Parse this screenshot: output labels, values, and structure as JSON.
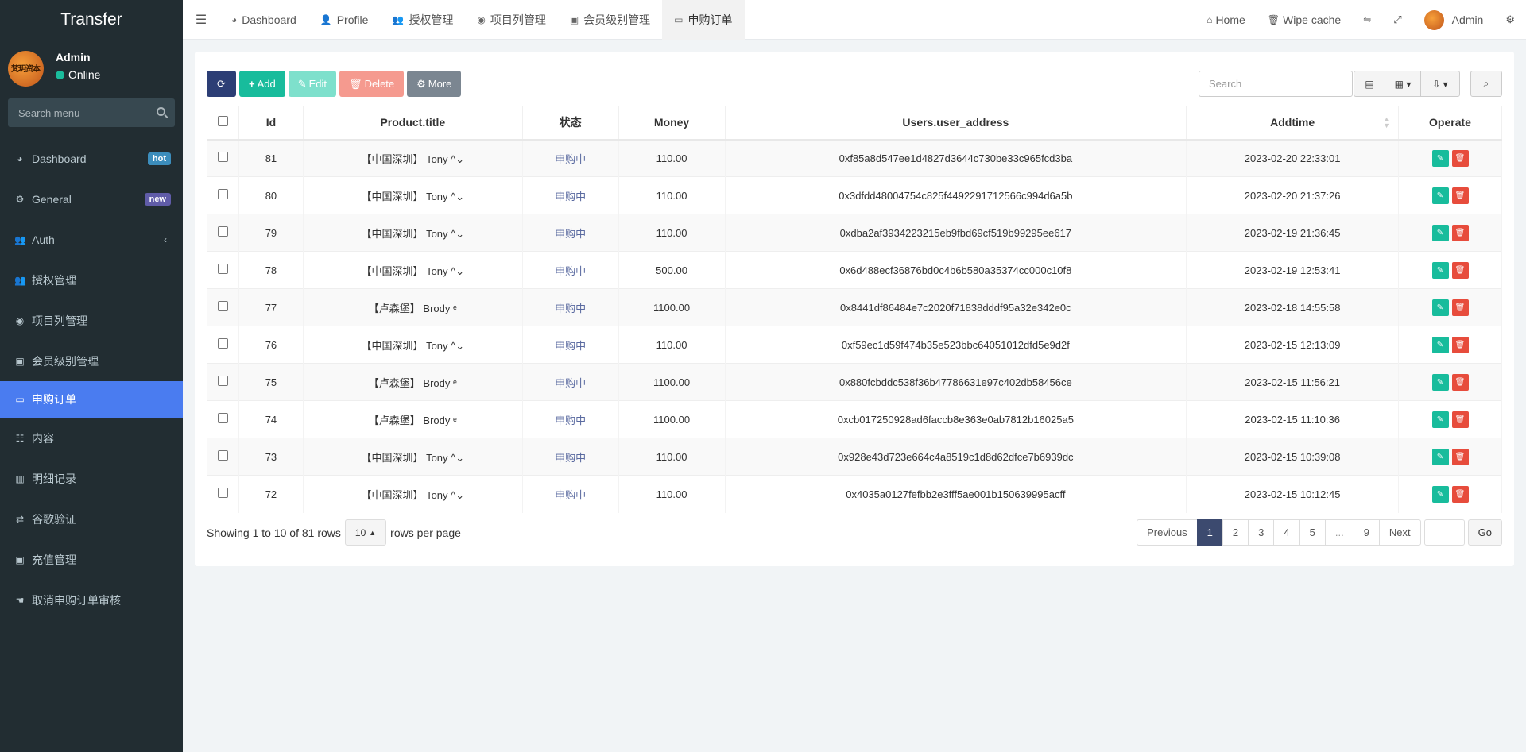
{
  "app": {
    "title": "Transfer"
  },
  "user": {
    "name": "Admin",
    "status": "Online",
    "avatar_text": "梵玥资本"
  },
  "sidebar": {
    "search_placeholder": "Search menu",
    "items": [
      {
        "label": "Dashboard",
        "icon": "dashboard-icon",
        "badge": "hot"
      },
      {
        "label": "General",
        "icon": "cogs-icon",
        "badge": "new"
      },
      {
        "label": "Auth",
        "icon": "users-icon",
        "chevron": "‹"
      },
      {
        "label": "授权管理",
        "icon": "users-icon"
      },
      {
        "label": "项目列管理",
        "icon": "compass-icon"
      },
      {
        "label": "会员级别管理",
        "icon": "calendar-check-icon"
      },
      {
        "label": "申购订单",
        "icon": "credit-card-icon",
        "active": true
      },
      {
        "label": "内容",
        "icon": "th-icon"
      },
      {
        "label": "明细记录",
        "icon": "bar-chart-icon"
      },
      {
        "label": "谷歌验证",
        "icon": "retweet-icon"
      },
      {
        "label": "充值管理",
        "icon": "calendar-check-icon"
      },
      {
        "label": "取消申购订单审核",
        "icon": "hand-icon"
      }
    ]
  },
  "topbar": {
    "tabs": [
      {
        "label": "Dashboard",
        "icon": "dashboard-icon"
      },
      {
        "label": "Profile",
        "icon": "user-icon"
      },
      {
        "label": "授权管理",
        "icon": "users-icon"
      },
      {
        "label": "项目列管理",
        "icon": "compass-icon"
      },
      {
        "label": "会员级别管理",
        "icon": "calendar-check-icon"
      },
      {
        "label": "申购订单",
        "icon": "credit-card-icon",
        "active": true
      }
    ],
    "home": "Home",
    "wipe_cache": "Wipe cache",
    "admin": "Admin"
  },
  "toolbar": {
    "add": "Add",
    "edit": "Edit",
    "delete": "Delete",
    "more": "More",
    "search_placeholder": "Search"
  },
  "table": {
    "columns": [
      "Id",
      "Product.title",
      "状态",
      "Money",
      "Users.user_address",
      "Addtime",
      "Operate"
    ],
    "rows": [
      {
        "id": "81",
        "product": "【中国深圳】 Tony ^⌄",
        "status": "申购中",
        "money": "110.00",
        "address": "0xf85a8d547ee1d4827d3644c730be33c965fcd3ba",
        "addtime": "2023-02-20 22:33:01"
      },
      {
        "id": "80",
        "product": "【中国深圳】 Tony ^⌄",
        "status": "申购中",
        "money": "110.00",
        "address": "0x3dfdd48004754c825f4492291712566c994d6a5b",
        "addtime": "2023-02-20 21:37:26"
      },
      {
        "id": "79",
        "product": "【中国深圳】 Tony ^⌄",
        "status": "申购中",
        "money": "110.00",
        "address": "0xdba2af3934223215eb9fbd69cf519b99295ee617",
        "addtime": "2023-02-19 21:36:45"
      },
      {
        "id": "78",
        "product": "【中国深圳】 Tony ^⌄",
        "status": "申购中",
        "money": "500.00",
        "address": "0x6d488ecf36876bd0c4b6b580a35374cc000c10f8",
        "addtime": "2023-02-19 12:53:41"
      },
      {
        "id": "77",
        "product": "【卢森堡】 Brody ᵉ",
        "status": "申购中",
        "money": "1100.00",
        "address": "0x8441df86484e7c2020f71838dddf95a32e342e0c",
        "addtime": "2023-02-18 14:55:58"
      },
      {
        "id": "76",
        "product": "【中国深圳】 Tony ^⌄",
        "status": "申购中",
        "money": "110.00",
        "address": "0xf59ec1d59f474b35e523bbc64051012dfd5e9d2f",
        "addtime": "2023-02-15 12:13:09"
      },
      {
        "id": "75",
        "product": "【卢森堡】 Brody ᵉ",
        "status": "申购中",
        "money": "1100.00",
        "address": "0x880fcbddc538f36b47786631e97c402db58456ce",
        "addtime": "2023-02-15 11:56:21"
      },
      {
        "id": "74",
        "product": "【卢森堡】 Brody ᵉ",
        "status": "申购中",
        "money": "1100.00",
        "address": "0xcb017250928ad6faccb8e363e0ab7812b16025a5",
        "addtime": "2023-02-15 11:10:36"
      },
      {
        "id": "73",
        "product": "【中国深圳】 Tony ^⌄",
        "status": "申购中",
        "money": "110.00",
        "address": "0x928e43d723e664c4a8519c1d8d62dfce7b6939dc",
        "addtime": "2023-02-15 10:39:08"
      },
      {
        "id": "72",
        "product": "【中国深圳】 Tony ^⌄",
        "status": "申购中",
        "money": "110.00",
        "address": "0x4035a0127fefbb2e3fff5ae001b150639995acff",
        "addtime": "2023-02-15 10:12:45"
      }
    ]
  },
  "footer": {
    "showing": "Showing 1 to 10 of 81 rows",
    "page_size": "10",
    "rows_per_page": "rows per page"
  },
  "pagination": {
    "previous": "Previous",
    "pages": [
      "1",
      "2",
      "3",
      "4",
      "5",
      "...",
      "9"
    ],
    "current": "1",
    "next": "Next",
    "go": "Go"
  },
  "colors": {
    "sidebar_bg": "#222d32",
    "active_menu": "#4a7cf0",
    "add_btn": "#18bc9c",
    "delete_op": "#e74c3c",
    "pagination_active": "#3c4a6f"
  }
}
